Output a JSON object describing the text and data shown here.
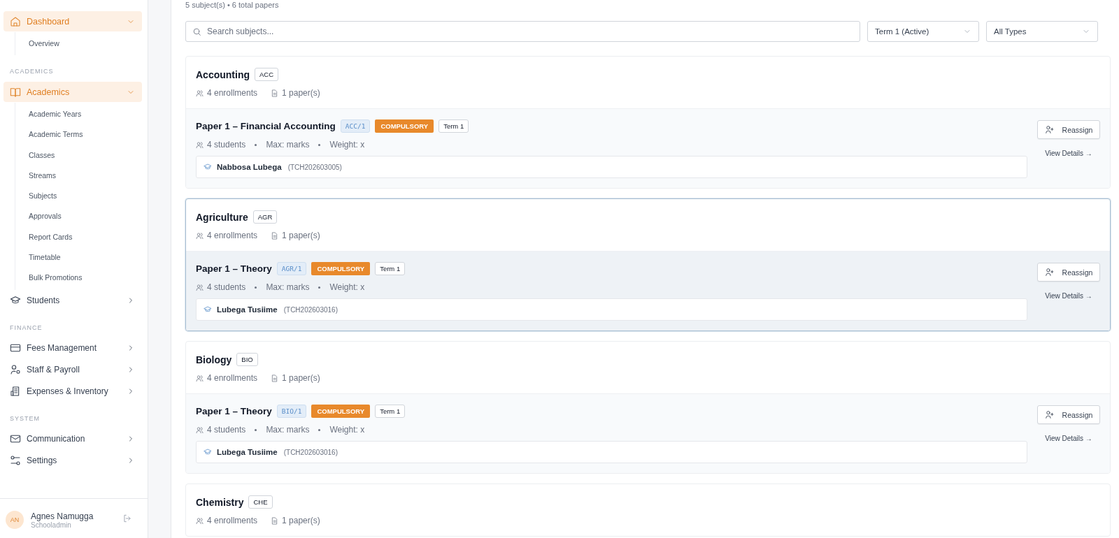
{
  "sidebar": {
    "groups": [
      {
        "items": [
          {
            "label": "Dashboard",
            "selected": true,
            "expanded": true,
            "children": [
              {
                "label": "Overview"
              }
            ]
          }
        ]
      },
      {
        "heading": "ACADEMICS",
        "items": [
          {
            "label": "Academics",
            "selected": true,
            "expanded": true,
            "children": [
              {
                "label": "Academic Years"
              },
              {
                "label": "Academic Terms"
              },
              {
                "label": "Classes"
              },
              {
                "label": "Streams"
              },
              {
                "label": "Subjects"
              },
              {
                "label": "Approvals"
              },
              {
                "label": "Report Cards"
              },
              {
                "label": "Timetable"
              },
              {
                "label": "Bulk Promotions"
              }
            ]
          },
          {
            "label": "Students",
            "selected": false,
            "expanded": false
          }
        ]
      },
      {
        "heading": "FINANCE",
        "items": [
          {
            "label": "Fees Management",
            "selected": false,
            "expanded": false
          },
          {
            "label": "Staff & Payroll",
            "selected": false,
            "expanded": false
          },
          {
            "label": "Expenses & Inventory",
            "selected": false,
            "expanded": false
          }
        ]
      },
      {
        "heading": "SYSTEM",
        "items": [
          {
            "label": "Communication",
            "selected": false,
            "expanded": false
          },
          {
            "label": "Settings",
            "selected": false,
            "expanded": false
          }
        ]
      }
    ],
    "user": {
      "initials": "AN",
      "name": "Agnes Namugga",
      "role": "Schooladmin"
    }
  },
  "summary": "5 subject(s) • 6 total papers",
  "search": {
    "placeholder": "Search subjects..."
  },
  "filters": [
    {
      "value": "Term 1 (Active)"
    },
    {
      "value": "All Types"
    }
  ],
  "subjects": [
    {
      "name": "Accounting",
      "code": "ACC",
      "enrollments": "4 enrollments",
      "paper_count": "1 paper(s)",
      "selected": false,
      "papers": [
        {
          "title": "Paper 1 – Financial Accounting",
          "code": "ACC/1",
          "type": "COMPULSORY",
          "term": "Term 1",
          "students": "4 students",
          "max": "Max: marks",
          "weight": "Weight: x",
          "teacher": "Nabbosa Lubega",
          "teacher_id": "(TCH202603005)",
          "action": "Reassign",
          "link": "View Details →"
        }
      ]
    },
    {
      "name": "Agriculture",
      "code": "AGR",
      "enrollments": "4 enrollments",
      "paper_count": "1 paper(s)",
      "selected": true,
      "papers": [
        {
          "title": "Paper 1 – Theory",
          "code": "AGR/1",
          "type": "COMPULSORY",
          "term": "Term 1",
          "students": "4 students",
          "max": "Max: marks",
          "weight": "Weight: x",
          "teacher": "Lubega Tusiime",
          "teacher_id": "(TCH202603016)",
          "action": "Reassign",
          "link": "View Details →"
        }
      ]
    },
    {
      "name": "Biology",
      "code": "BIO",
      "enrollments": "4 enrollments",
      "paper_count": "1 paper(s)",
      "selected": false,
      "papers": [
        {
          "title": "Paper 1 – Theory",
          "code": "BIO/1",
          "type": "COMPULSORY",
          "term": "Term 1",
          "students": "4 students",
          "max": "Max: marks",
          "weight": "Weight: x",
          "teacher": "Lubega Tusiime",
          "teacher_id": "(TCH202603016)",
          "action": "Reassign",
          "link": "View Details →"
        }
      ]
    },
    {
      "name": "Chemistry",
      "code": "CHE",
      "enrollments": "4 enrollments",
      "paper_count": "1 paper(s)",
      "selected": false
    }
  ]
}
